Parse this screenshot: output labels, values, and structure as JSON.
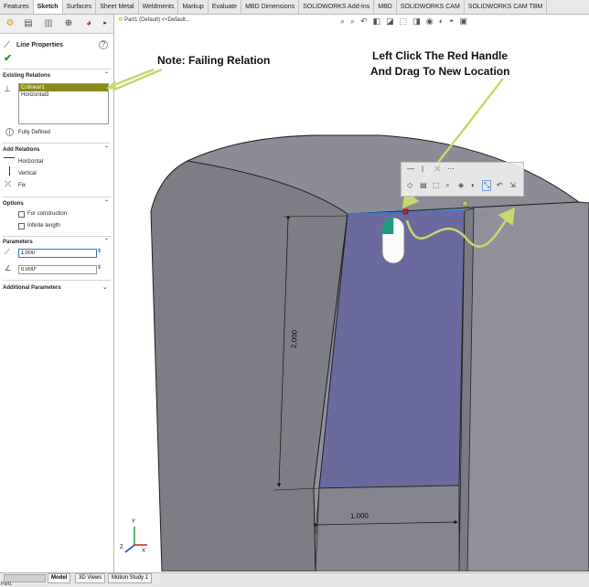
{
  "command_tabs": [
    "Features",
    "Sketch",
    "Surfaces",
    "Sheet Metal",
    "Weldments",
    "Markup",
    "Evaluate",
    "MBD Dimensions",
    "SOLIDWORKS Add-Ins",
    "MBD",
    "SOLIDWORKS CAM",
    "SOLIDWORKS CAM TBM"
  ],
  "tree_path": "Part1 (Default) <<Default...",
  "panel": {
    "title": "Line Properties",
    "existing_relations_label": "Existing Relations",
    "existing_relations": [
      "Colinear1",
      "Horizontal3"
    ],
    "status": "Fully Defined",
    "add_relations_label": "Add Relations",
    "add_relations": [
      "Horizontal",
      "Vertical",
      "Fix"
    ],
    "options_label": "Options",
    "option_construction": "For construction",
    "option_infinite": "Infinite length",
    "parameters_label": "Parameters",
    "length_value": "1.000",
    "angle_value": "0.000°",
    "additional_label": "Additional Parameters"
  },
  "annotations": {
    "note": "Note: Failing Relation",
    "instruction_line1": "Left Click The Red Handle",
    "instruction_line2": "And Drag To New Location"
  },
  "dimensions": {
    "vertical": "2.000",
    "horizontal": "1.000"
  },
  "bottom_tabs": [
    "Model",
    "3D Views",
    "Motion Study 1"
  ],
  "status_bar": "Part1",
  "colors": {
    "accent": "#c8d86a",
    "relation_highlight": "#8b8b1a",
    "body_face": "#8a8a96",
    "sketch_face": "#6b6b9c"
  }
}
